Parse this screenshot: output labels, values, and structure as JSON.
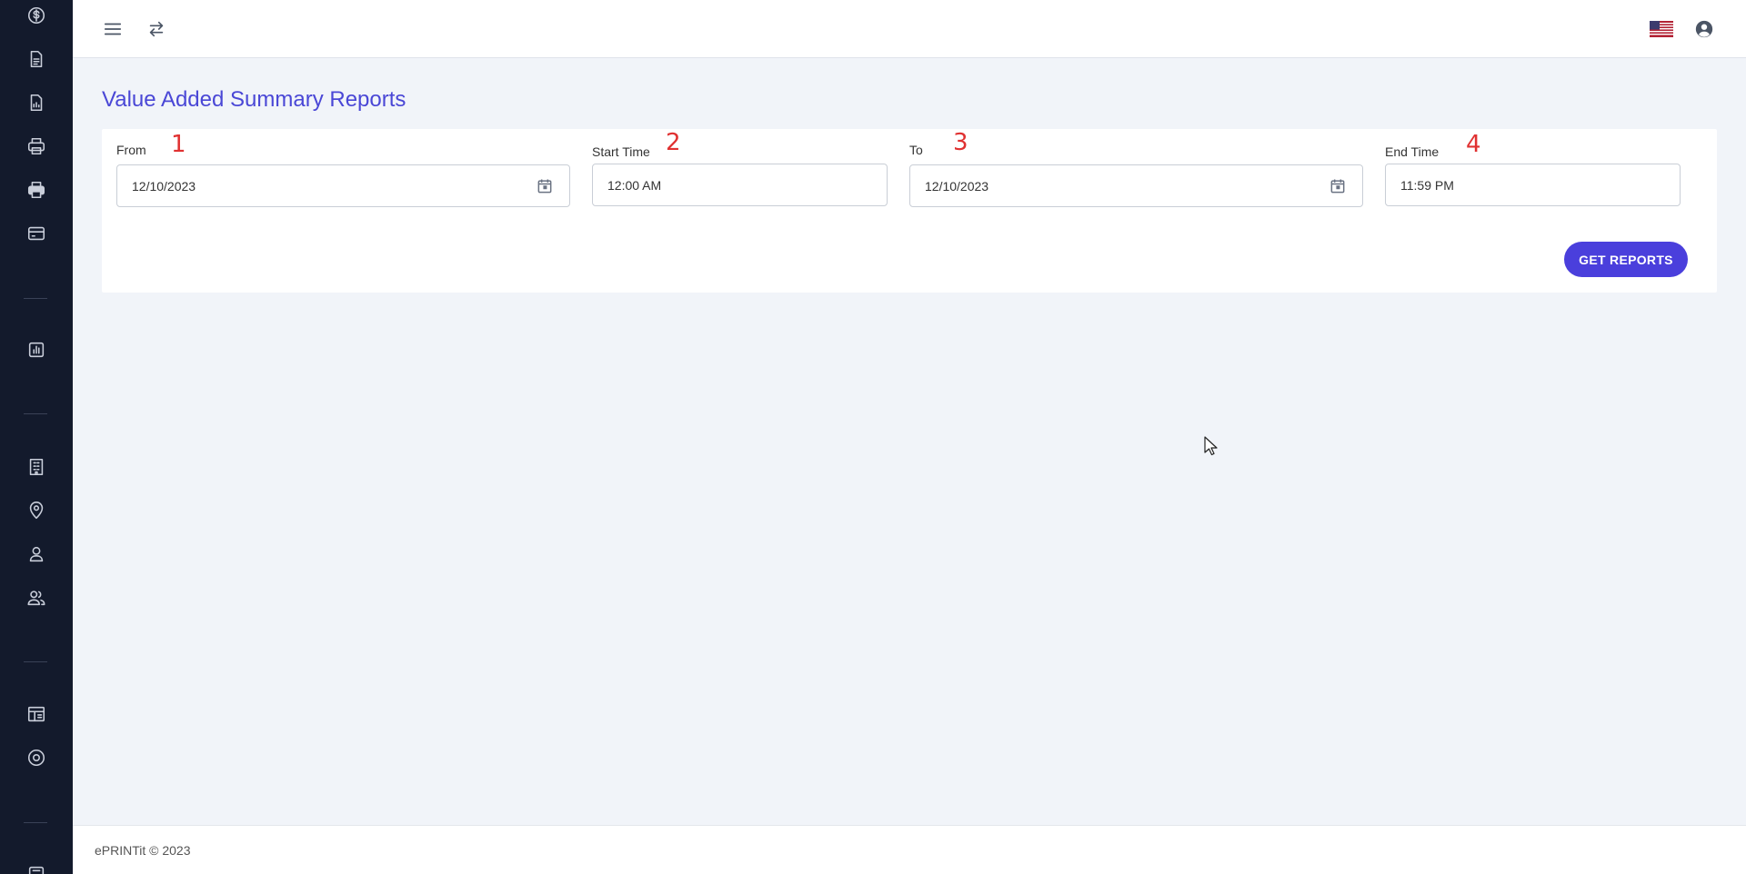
{
  "sidebar": {
    "icons": [
      {
        "name": "dollar-icon"
      },
      {
        "name": "document-icon"
      },
      {
        "name": "report-document-icon"
      },
      {
        "name": "printer-icon"
      },
      {
        "name": "printer-filled-icon"
      },
      {
        "name": "card-icon"
      },
      {
        "name": "bar-chart-icon"
      },
      {
        "name": "building-icon"
      },
      {
        "name": "location-icon"
      },
      {
        "name": "user-icon"
      },
      {
        "name": "users-icon"
      },
      {
        "name": "layout-icon"
      },
      {
        "name": "settings-circle-icon"
      }
    ],
    "background": "#131a2c"
  },
  "topbar": {
    "menu_icon": "menu-icon",
    "swap_icon": "swap-icon",
    "flag_icon": "us-flag-icon",
    "account_icon": "account-circle-icon"
  },
  "page": {
    "title": "Value Added Summary Reports"
  },
  "form": {
    "from": {
      "label": "From",
      "value": "12/10/2023",
      "step": "1"
    },
    "start_time": {
      "label": "Start Time",
      "value": "12:00 AM",
      "step": "2"
    },
    "to": {
      "label": "To",
      "value": "12/10/2023",
      "step": "3"
    },
    "end_time": {
      "label": "End Time",
      "value": "11:59 PM",
      "step": "4"
    },
    "submit_label": "GET REPORTS"
  },
  "footer": {
    "text": "ePRINTit © 2023"
  },
  "colors": {
    "accent": "#4a3fdc",
    "title": "#4a47d6",
    "annotation": "#e03131"
  }
}
